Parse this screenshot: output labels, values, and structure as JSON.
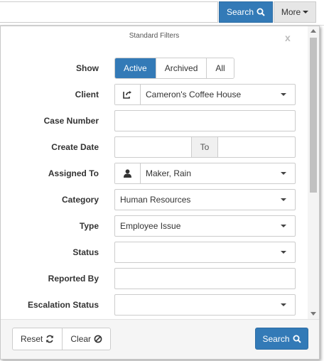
{
  "topbar": {
    "search_label": "Search",
    "more_label": "More"
  },
  "panel": {
    "title": "Standard Filters",
    "close_label": "x"
  },
  "filters": {
    "show": {
      "label": "Show",
      "options": [
        "Active",
        "Archived",
        "All"
      ],
      "selected": "Active"
    },
    "client": {
      "label": "Client",
      "value": "Cameron's Coffee House"
    },
    "case_number": {
      "label": "Case Number",
      "value": ""
    },
    "create_date": {
      "label": "Create Date",
      "from": "",
      "to_label": "To",
      "to": ""
    },
    "assigned_to": {
      "label": "Assigned To",
      "value": "Maker, Rain"
    },
    "category": {
      "label": "Category",
      "value": "Human Resources"
    },
    "type": {
      "label": "Type",
      "value": "Employee Issue"
    },
    "status": {
      "label": "Status",
      "value": ""
    },
    "reported_by": {
      "label": "Reported By",
      "value": ""
    },
    "escalation_status": {
      "label": "Escalation Status",
      "value": ""
    }
  },
  "footer": {
    "reset_label": "Reset",
    "clear_label": "Clear",
    "search_label": "Search"
  },
  "colors": {
    "primary": "#337ab7",
    "primary_border": "#2e6da4"
  }
}
